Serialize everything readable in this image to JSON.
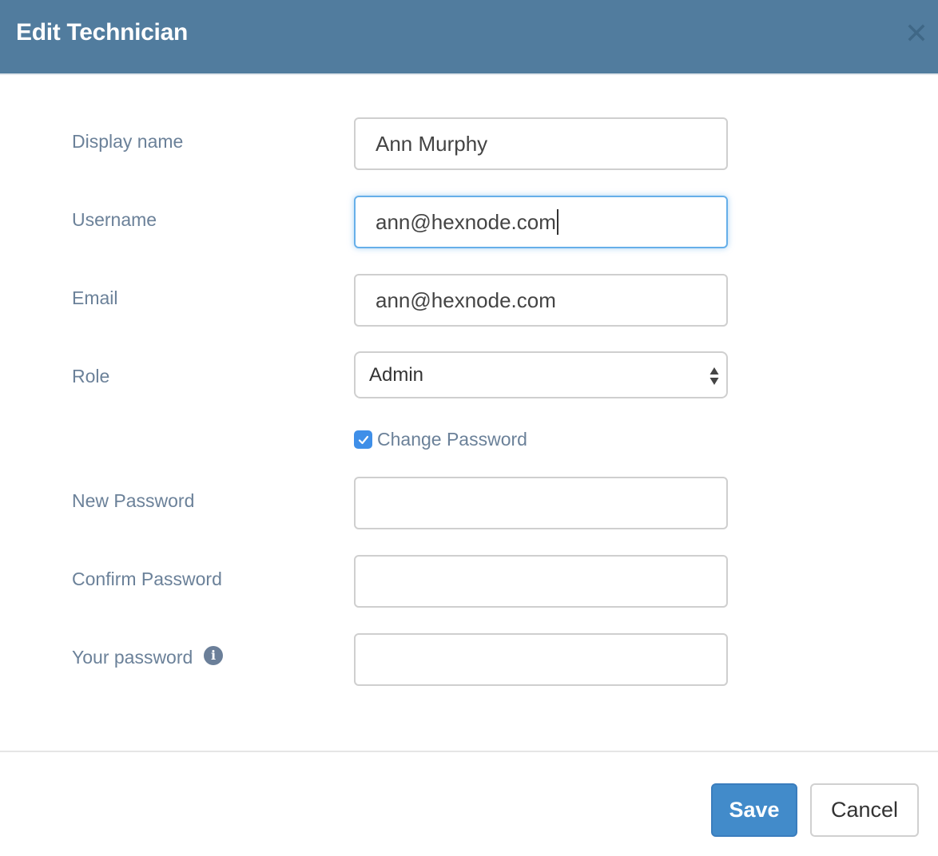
{
  "dialog": {
    "title": "Edit Technician",
    "close_icon": "close-icon"
  },
  "form": {
    "display_name": {
      "label": "Display name",
      "value": "Ann Murphy"
    },
    "username": {
      "label": "Username",
      "value": "ann@hexnode.com",
      "focused": true
    },
    "email": {
      "label": "Email",
      "value": "ann@hexnode.com"
    },
    "role": {
      "label": "Role",
      "selected": "Admin"
    },
    "change_password": {
      "label": "Change Password",
      "checked": true
    },
    "new_password": {
      "label": "New Password",
      "value": ""
    },
    "confirm_password": {
      "label": "Confirm Password",
      "value": ""
    },
    "your_password": {
      "label": "Your password",
      "value": "",
      "info_icon": "info-icon"
    }
  },
  "footer": {
    "save_label": "Save",
    "cancel_label": "Cancel"
  },
  "colors": {
    "header_bg": "#517c9e",
    "primary": "#428bca",
    "label": "#6b8199",
    "focus": "#66afe9",
    "checkbox": "#3f8fe8"
  }
}
